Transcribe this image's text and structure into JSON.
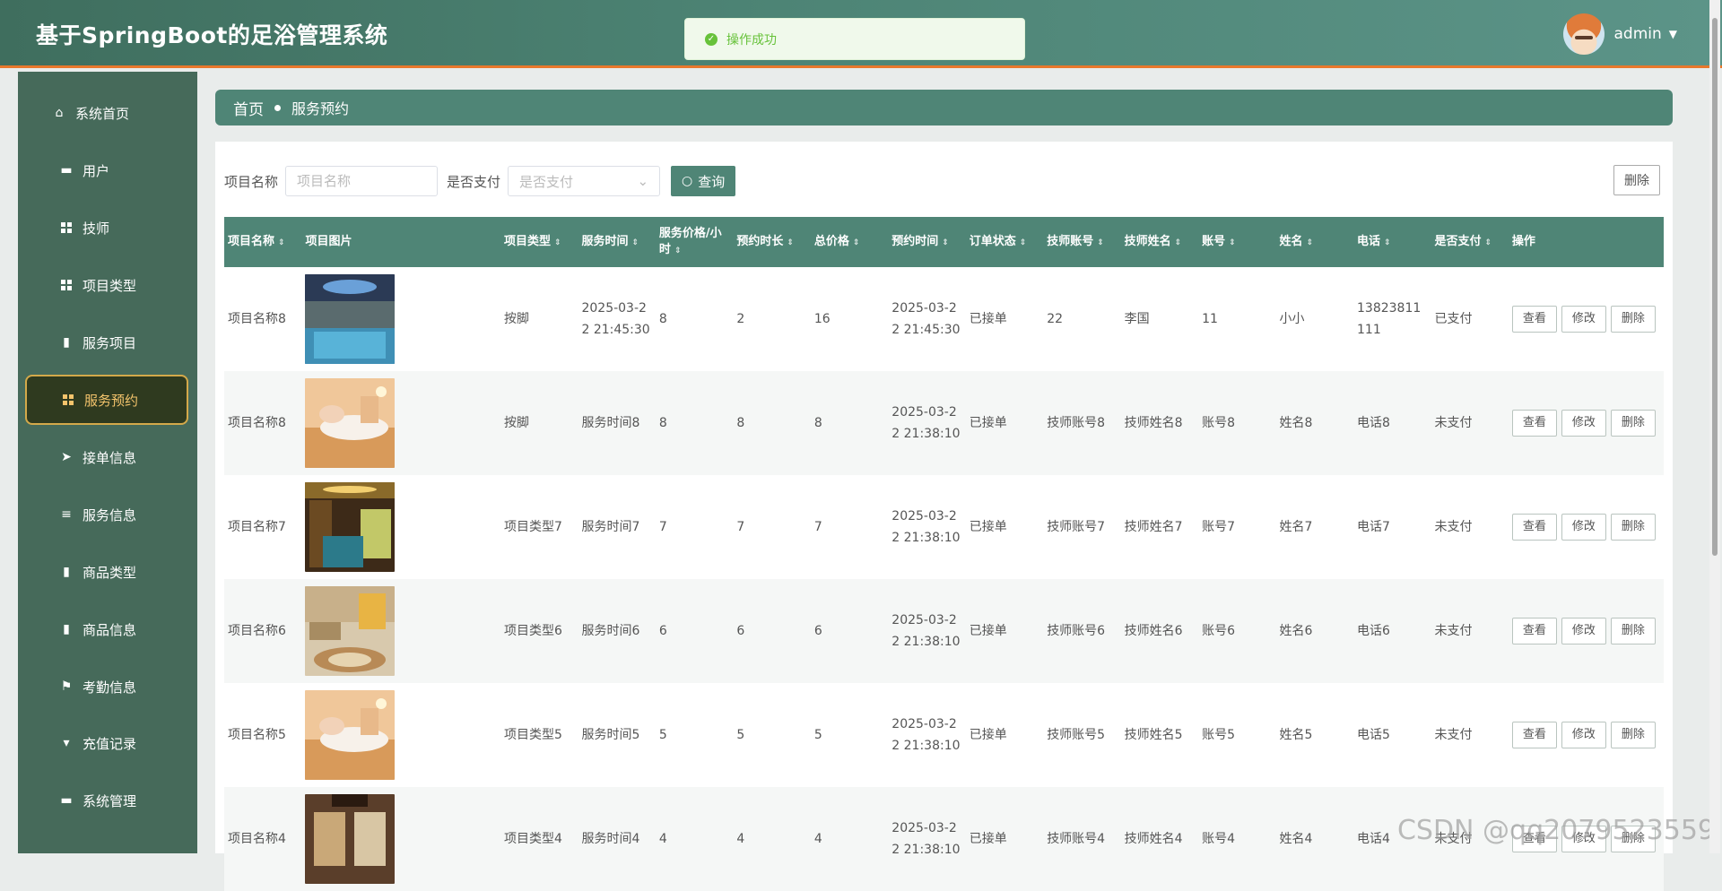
{
  "header": {
    "title": "基于SpringBoot的足浴管理系统",
    "username": "admin"
  },
  "toast": {
    "message": "操作成功",
    "color": "#67c23a"
  },
  "sidebar": {
    "items": [
      {
        "label": "系统首页",
        "icon": "home-icon"
      },
      {
        "label": "用户",
        "icon": "briefcase-icon"
      },
      {
        "label": "技师",
        "icon": "grid-icon"
      },
      {
        "label": "项目类型",
        "icon": "grid-icon"
      },
      {
        "label": "服务项目",
        "icon": "book-icon"
      },
      {
        "label": "服务预约",
        "icon": "grid-icon",
        "active": true
      },
      {
        "label": "接单信息",
        "icon": "send-icon"
      },
      {
        "label": "服务信息",
        "icon": "list-icon"
      },
      {
        "label": "商品类型",
        "icon": "clipboard-icon"
      },
      {
        "label": "商品信息",
        "icon": "clipboard-x-icon"
      },
      {
        "label": "考勤信息",
        "icon": "flag-icon"
      },
      {
        "label": "充值记录",
        "icon": "pin-icon"
      },
      {
        "label": "系统管理",
        "icon": "server-icon"
      }
    ]
  },
  "breadcrumb": {
    "home": "首页",
    "current": "服务预约"
  },
  "filters": {
    "name_label": "项目名称",
    "name_placeholder": "项目名称",
    "paid_label": "是否支付",
    "paid_placeholder": "是否支付",
    "query_button": "查询",
    "delete_button": "删除"
  },
  "table": {
    "columns": [
      "项目名称",
      "项目图片",
      "项目类型",
      "服务时间",
      "服务价格/小时",
      "预约时长",
      "总价格",
      "预约时间",
      "订单状态",
      "技师账号",
      "技师姓名",
      "账号",
      "姓名",
      "电话",
      "是否支付",
      "操作"
    ],
    "actions": [
      "查看",
      "修改",
      "删除"
    ],
    "rows": [
      {
        "name": "项目名称8",
        "image": "hall-pool",
        "type": "按脚",
        "service_time": "2025-03-22 21:45:30",
        "price": "8",
        "duration": "2",
        "total": "16",
        "book_time": "2025-03-22 21:45:30",
        "status": "已接单",
        "tech_account": "22",
        "tech_name": "李国",
        "account": "11",
        "user_name": "小小",
        "phone": "13823811111",
        "paid": "已支付"
      },
      {
        "name": "项目名称8",
        "image": "massage",
        "type": "按脚",
        "service_time": "服务时间8",
        "price": "8",
        "duration": "8",
        "total": "8",
        "book_time": "2025-03-22 21:38:10",
        "status": "已接单",
        "tech_account": "技师账号8",
        "tech_name": "技师姓名8",
        "account": "账号8",
        "user_name": "姓名8",
        "phone": "电话8",
        "paid": "未支付"
      },
      {
        "name": "项目名称7",
        "image": "pool-room",
        "type": "项目类型7",
        "service_time": "服务时间7",
        "price": "7",
        "duration": "7",
        "total": "7",
        "book_time": "2025-03-22 21:38:10",
        "status": "已接单",
        "tech_account": "技师账号7",
        "tech_name": "技师姓名7",
        "account": "账号7",
        "user_name": "姓名7",
        "phone": "电话7",
        "paid": "未支付"
      },
      {
        "name": "项目名称6",
        "image": "lobby",
        "type": "项目类型6",
        "service_time": "服务时间6",
        "price": "6",
        "duration": "6",
        "total": "6",
        "book_time": "2025-03-22 21:38:10",
        "status": "已接单",
        "tech_account": "技师账号6",
        "tech_name": "技师姓名6",
        "account": "账号6",
        "user_name": "姓名6",
        "phone": "电话6",
        "paid": "未支付"
      },
      {
        "name": "项目名称5",
        "image": "massage",
        "type": "项目类型5",
        "service_time": "服务时间5",
        "price": "5",
        "duration": "5",
        "total": "5",
        "book_time": "2025-03-22 21:38:10",
        "status": "已接单",
        "tech_account": "技师账号5",
        "tech_name": "技师姓名5",
        "account": "账号5",
        "user_name": "姓名5",
        "phone": "电话5",
        "paid": "未支付"
      },
      {
        "name": "项目名称4",
        "image": "room",
        "type": "项目类型4",
        "service_time": "服务时间4",
        "price": "4",
        "duration": "4",
        "total": "4",
        "book_time": "2025-03-22 21:38:10",
        "status": "已接单",
        "tech_account": "技师账号4",
        "tech_name": "技师姓名4",
        "account": "账号4",
        "user_name": "姓名4",
        "phone": "电话4",
        "paid": "未支付"
      }
    ]
  },
  "watermark": "CSDN @qq2079523559",
  "colors": {
    "accent": "#4f8576",
    "sidebar": "#466a5a",
    "header_border": "#e8782c",
    "active_text": "#f4c46c"
  }
}
